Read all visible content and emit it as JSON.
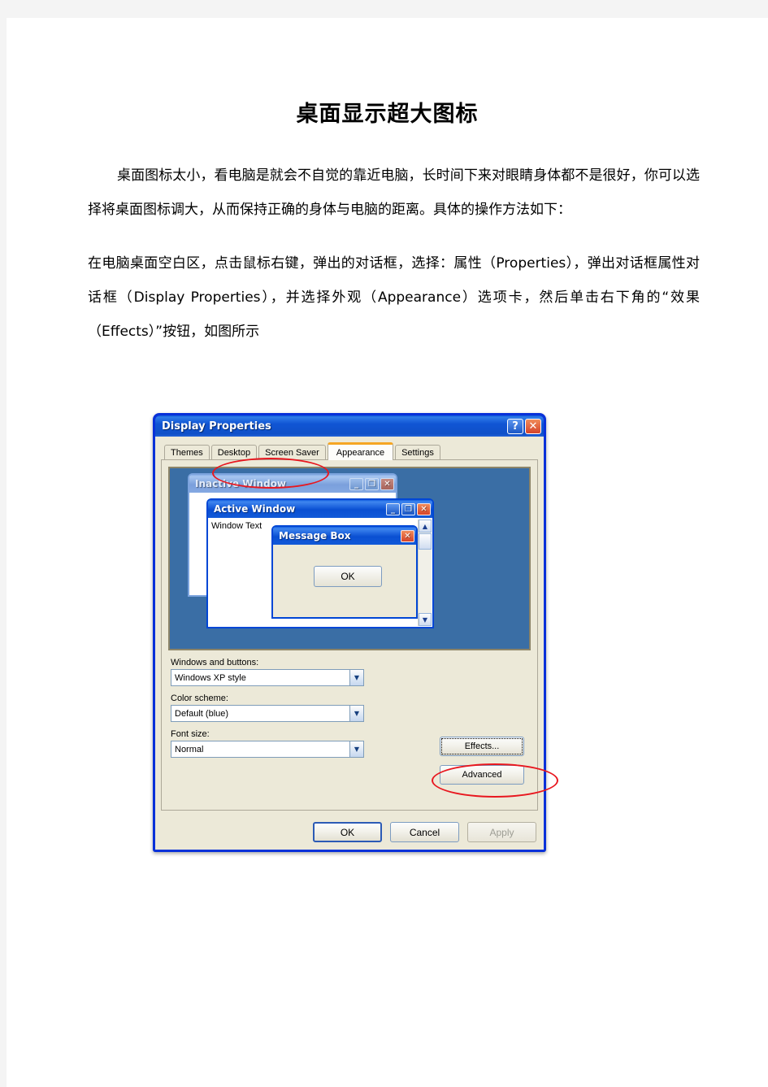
{
  "document": {
    "title": "桌面显示超大图标",
    "paragraph_1": "桌面图标太小，看电脑是就会不自觉的靠近电脑，长时间下来对眼睛身体都不是很好，你可以选择将桌面图标调大，从而保持正确的身体与电脑的距离。具体的操作方法如下：",
    "paragraph_2": "在电脑桌面空白区，点击鼠标右键，弹出的对话框，选择：属性（Properties），弹出对话框属性对话框（Display Properties），并选择外观（Appearance）选项卡，然后单击右下角的“效果（Effects）”按钮，如图所示"
  },
  "dialog": {
    "title": "Display Properties",
    "help_button": "?",
    "close_button": "✕",
    "tabs": [
      {
        "label": "Themes",
        "active": false
      },
      {
        "label": "Desktop",
        "active": false
      },
      {
        "label": "Screen Saver",
        "active": false
      },
      {
        "label": "Appearance",
        "active": true
      },
      {
        "label": "Settings",
        "active": false
      }
    ],
    "preview": {
      "inactive_window": {
        "title": "Inactive Window",
        "minimize": "_",
        "maximize": "❐",
        "close": "✕"
      },
      "active_window": {
        "title": "Active Window",
        "body_text": "Window Text",
        "minimize": "_",
        "maximize": "❐",
        "close": "✕",
        "scroll_up": "▲",
        "scroll_down": "▼"
      },
      "message_box": {
        "title": "Message Box",
        "close": "✕",
        "ok_button": "OK"
      }
    },
    "fields": [
      {
        "label": "Windows and buttons:",
        "value": "Windows XP style",
        "arrow": "▼"
      },
      {
        "label": "Color scheme:",
        "value": "Default (blue)",
        "arrow": "▼"
      },
      {
        "label": "Font size:",
        "value": "Normal",
        "arrow": "▼"
      }
    ],
    "side_buttons": {
      "effects": "Effects...",
      "advanced": "Advanced"
    },
    "footer_buttons": {
      "ok": "OK",
      "cancel": "Cancel",
      "apply": "Apply"
    }
  },
  "annotations": {
    "appearance_highlight_color": "#e8171f",
    "effects_highlight_color": "#e8171f"
  }
}
